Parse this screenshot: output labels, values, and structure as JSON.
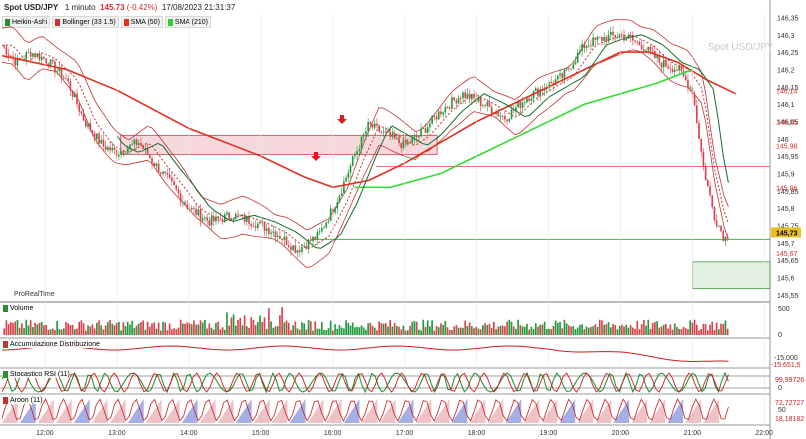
{
  "header": {
    "instrument": "Spot USD/JPY",
    "interval": "1 minuto",
    "price": "145.73",
    "change": "(-0.42%)",
    "datetime": "17/08/2023 21:31:37"
  },
  "legend": [
    {
      "label": "Heikin-Ashi",
      "color": "#2e8b2e"
    },
    {
      "label": "Bollinger (33 1.5)",
      "color": "#c83232"
    },
    {
      "label": "SMA (50)",
      "color": "#e03020"
    },
    {
      "label": "SMA (210)",
      "color": "#33cc33"
    }
  ],
  "watermark": "Spot USD/JPY",
  "brand": "ProRealTime",
  "colors": {
    "up": "#1f9a3a",
    "down": "#d9414a",
    "sma50": "#e03020",
    "sma210": "#33dd33",
    "bollinger": "#c83232",
    "zone": "#e06070"
  },
  "chart_data": {
    "type": "candlestick",
    "x_ticks": [
      "12:00",
      "13:00",
      "14:00",
      "15:00",
      "16:00",
      "17:00",
      "18:00",
      "19:00",
      "20:00",
      "21:00",
      "22:00"
    ],
    "x_tick_times": [
      12,
      13,
      14,
      15,
      16,
      17,
      18,
      19,
      20,
      21,
      22
    ],
    "y_ticks": [
      "146,35",
      "146,3",
      "146,25",
      "146,2",
      "146,15",
      "146,1",
      "146,05",
      "146",
      "145,95",
      "145,9",
      "145,85",
      "145,8",
      "145,75",
      "145,7",
      "145,65",
      "145,6",
      "145,55"
    ],
    "y_tick_values": [
      146.35,
      146.3,
      146.25,
      146.2,
      146.15,
      146.1,
      146.05,
      146.0,
      145.95,
      145.9,
      145.85,
      145.8,
      145.75,
      145.7,
      145.65,
      145.6,
      145.55
    ],
    "ylim": [
      145.535,
      146.36
    ],
    "xlim": [
      11.4,
      22.05
    ],
    "price_path": [
      [
        11.4,
        146.27
      ],
      [
        11.6,
        146.22
      ],
      [
        11.8,
        146.25
      ],
      [
        12.0,
        146.23
      ],
      [
        12.3,
        146.17
      ],
      [
        12.55,
        146.05
      ],
      [
        12.8,
        145.98
      ],
      [
        13.0,
        145.96
      ],
      [
        13.3,
        145.99
      ],
      [
        13.55,
        145.92
      ],
      [
        13.75,
        145.87
      ],
      [
        14.0,
        145.8
      ],
      [
        14.3,
        145.76
      ],
      [
        14.6,
        145.78
      ],
      [
        14.9,
        145.76
      ],
      [
        15.2,
        145.73
      ],
      [
        15.5,
        145.68
      ],
      [
        15.8,
        145.72
      ],
      [
        16.05,
        145.82
      ],
      [
        16.3,
        145.95
      ],
      [
        16.5,
        146.04
      ],
      [
        16.75,
        146.01
      ],
      [
        17.0,
        145.98
      ],
      [
        17.2,
        146.01
      ],
      [
        17.5,
        146.08
      ],
      [
        17.8,
        146.13
      ],
      [
        18.1,
        146.1
      ],
      [
        18.4,
        146.06
      ],
      [
        18.7,
        146.12
      ],
      [
        18.95,
        146.15
      ],
      [
        19.2,
        146.18
      ],
      [
        19.5,
        146.27
      ],
      [
        19.75,
        146.29
      ],
      [
        20.0,
        146.3
      ],
      [
        20.3,
        146.27
      ],
      [
        20.55,
        146.22
      ],
      [
        20.8,
        146.2
      ],
      [
        21.0,
        146.14
      ],
      [
        21.15,
        145.92
      ],
      [
        21.3,
        145.78
      ],
      [
        21.45,
        145.71
      ],
      [
        21.5,
        145.73
      ]
    ],
    "last_price": 145.73,
    "price_labels": [
      {
        "value": 146.14,
        "text": "146,14"
      },
      {
        "value": 146.05,
        "text": "146,05"
      },
      {
        "value": 145.98,
        "text": "145,98"
      },
      {
        "value": 145.86,
        "text": "145,86"
      },
      {
        "value": 145.73,
        "text": "145,73"
      },
      {
        "value": 145.67,
        "text": "145,67"
      }
    ],
    "sma50": [
      [
        11.4,
        146.24
      ],
      [
        12.3,
        146.2
      ],
      [
        13.0,
        146.14
      ],
      [
        14.0,
        146.03
      ],
      [
        15.0,
        145.95
      ],
      [
        15.6,
        145.89
      ],
      [
        16.0,
        145.86
      ],
      [
        16.5,
        145.88
      ],
      [
        17.0,
        145.93
      ],
      [
        17.5,
        145.99
      ],
      [
        18.0,
        146.05
      ],
      [
        18.5,
        146.1
      ],
      [
        19.0,
        146.15
      ],
      [
        19.5,
        146.2
      ],
      [
        20.0,
        146.25
      ],
      [
        20.4,
        146.25
      ],
      [
        20.8,
        146.22
      ],
      [
        21.2,
        146.17
      ],
      [
        21.6,
        146.13
      ]
    ],
    "sma210": [
      [
        16.3,
        145.86
      ],
      [
        16.8,
        145.86
      ],
      [
        17.5,
        145.9
      ],
      [
        18.0,
        145.95
      ],
      [
        18.5,
        146.0
      ],
      [
        19.0,
        146.05
      ],
      [
        19.5,
        146.1
      ],
      [
        20.0,
        146.13
      ],
      [
        20.5,
        146.16
      ],
      [
        21.0,
        146.2
      ]
    ],
    "zones": [
      {
        "x": [
          13.05,
          17.45
        ],
        "y": [
          145.955,
          146.01
        ]
      },
      {
        "x": [
          16.6,
          22.05
        ],
        "y": [
          145.92,
          145.92
        ]
      }
    ],
    "volume": {
      "y_ticks": [
        "500",
        "0"
      ],
      "label": "Volume"
    },
    "accumulation": {
      "label": "Accumulazione Distribuzione",
      "y_ticks": [
        "-15.000"
      ],
      "value_label": "-15.651,5"
    },
    "stoch_rsi": {
      "label": "Stocastico RSI (11)",
      "value_labels": [
        "99,99726",
        "0"
      ]
    },
    "aroon": {
      "label": "Aroon (11)",
      "value_labels": [
        "72,72727",
        "50",
        "18,18182"
      ]
    }
  },
  "volume_axis": {
    "top": "500",
    "bottom": "0"
  },
  "accum_axis": {
    "top": "-15.000"
  }
}
